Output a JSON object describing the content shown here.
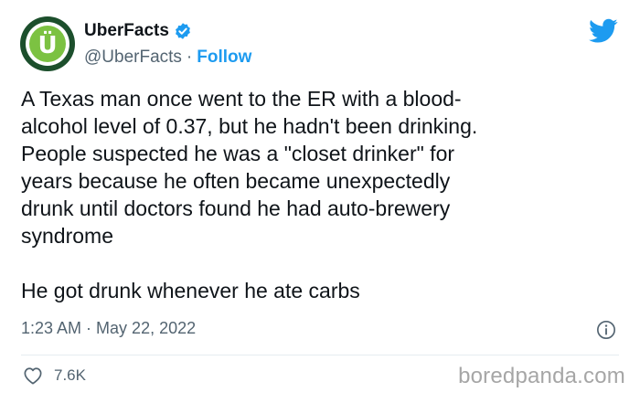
{
  "author": {
    "display_name": "UberFacts",
    "handle": "@UberFacts",
    "separator": "·",
    "follow_label": "Follow",
    "avatar_letter": "Ü"
  },
  "tweet": {
    "body": "A Texas man once went to the ER with a blood-\nalcohol level of 0.37, but he hadn't been drinking.\nPeople suspected he was a \"closet drinker\" for\nyears because he often became unexpectedly\ndrunk until doctors found he had auto-brewery\nsyndrome\n\nHe got drunk whenever he ate carbs",
    "time": "1:23 AM",
    "date_separator": "·",
    "date": "May 22, 2022",
    "likes": "7.6K"
  },
  "watermark": "boredpanda.com",
  "colors": {
    "accent": "#1d9bf0",
    "avatar_green": "#7cc242",
    "avatar_dark": "#1c4f2c",
    "secondary_text": "#536471"
  },
  "icons": {
    "verified": "verified-badge-icon",
    "bird": "twitter-bird-icon",
    "info": "info-icon",
    "like": "heart-icon"
  }
}
